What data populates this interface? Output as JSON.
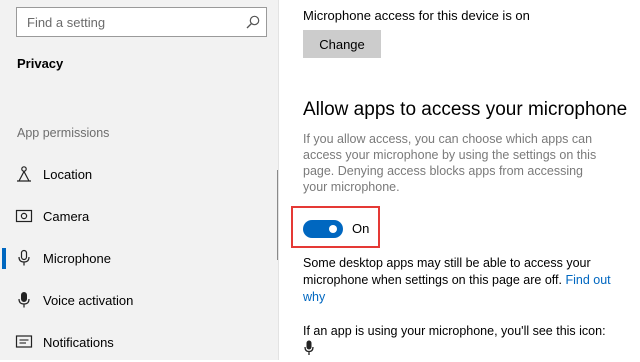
{
  "sidebar": {
    "search_placeholder": "Find a setting",
    "section_title": "Privacy",
    "group_title": "App permissions",
    "items": [
      {
        "label": "Location",
        "icon": "location-icon",
        "selected": false
      },
      {
        "label": "Camera",
        "icon": "camera-icon",
        "selected": false
      },
      {
        "label": "Microphone",
        "icon": "microphone-icon",
        "selected": true
      },
      {
        "label": "Voice activation",
        "icon": "voice-activation-icon",
        "selected": false
      },
      {
        "label": "Notifications",
        "icon": "notifications-icon",
        "selected": false
      }
    ]
  },
  "main": {
    "access_status": "Microphone access for this device is on",
    "change_label": "Change",
    "heading": "Allow apps to access your microphone",
    "description": "If you allow access, you can choose which apps can access your microphone by using the settings on this page. Denying access blocks apps from accessing your microphone.",
    "toggle": {
      "state": true,
      "label": "On"
    },
    "note_text": "Some desktop apps may still be able to access your microphone when settings on this page are off.",
    "note_link": "Find out why",
    "icon_note": "If an app is using your microphone, you'll see this icon:"
  },
  "colors": {
    "accent": "#0067c0",
    "highlight": "#e53935",
    "sidebar_bg": "#f2f2f2"
  }
}
